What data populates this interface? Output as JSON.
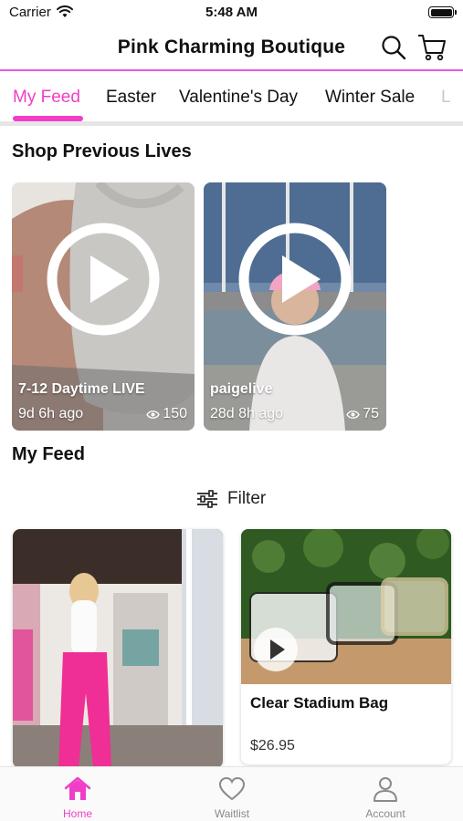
{
  "status_bar": {
    "carrier": "Carrier",
    "time": "5:48 AM"
  },
  "header": {
    "title": "Pink Charming Boutique"
  },
  "tabs": [
    {
      "label": "My Feed",
      "active": true
    },
    {
      "label": "Easter"
    },
    {
      "label": "Valentine's Day"
    },
    {
      "label": "Winter Sale"
    },
    {
      "label": "L"
    }
  ],
  "sections": {
    "previous_lives": "Shop Previous Lives",
    "my_feed": "My Feed"
  },
  "lives": [
    {
      "name": "7-12 Daytime LIVE",
      "ago": "9d 6h ago",
      "views": "150"
    },
    {
      "name": "paigelive",
      "ago": "28d 8h ago",
      "views": "75"
    }
  ],
  "filter": {
    "label": "Filter"
  },
  "feed": [
    {
      "name": "",
      "price": ""
    },
    {
      "name": "Clear Stadium Bag",
      "price": "$26.95"
    }
  ],
  "bottom_nav": [
    {
      "label": "Home",
      "icon": "home-icon",
      "active": true
    },
    {
      "label": "Waitlist",
      "icon": "heart-icon"
    },
    {
      "label": "Account",
      "icon": "person-icon"
    }
  ],
  "colors": {
    "accent": "#f03ec8",
    "header_rule": "#e25ae0"
  }
}
